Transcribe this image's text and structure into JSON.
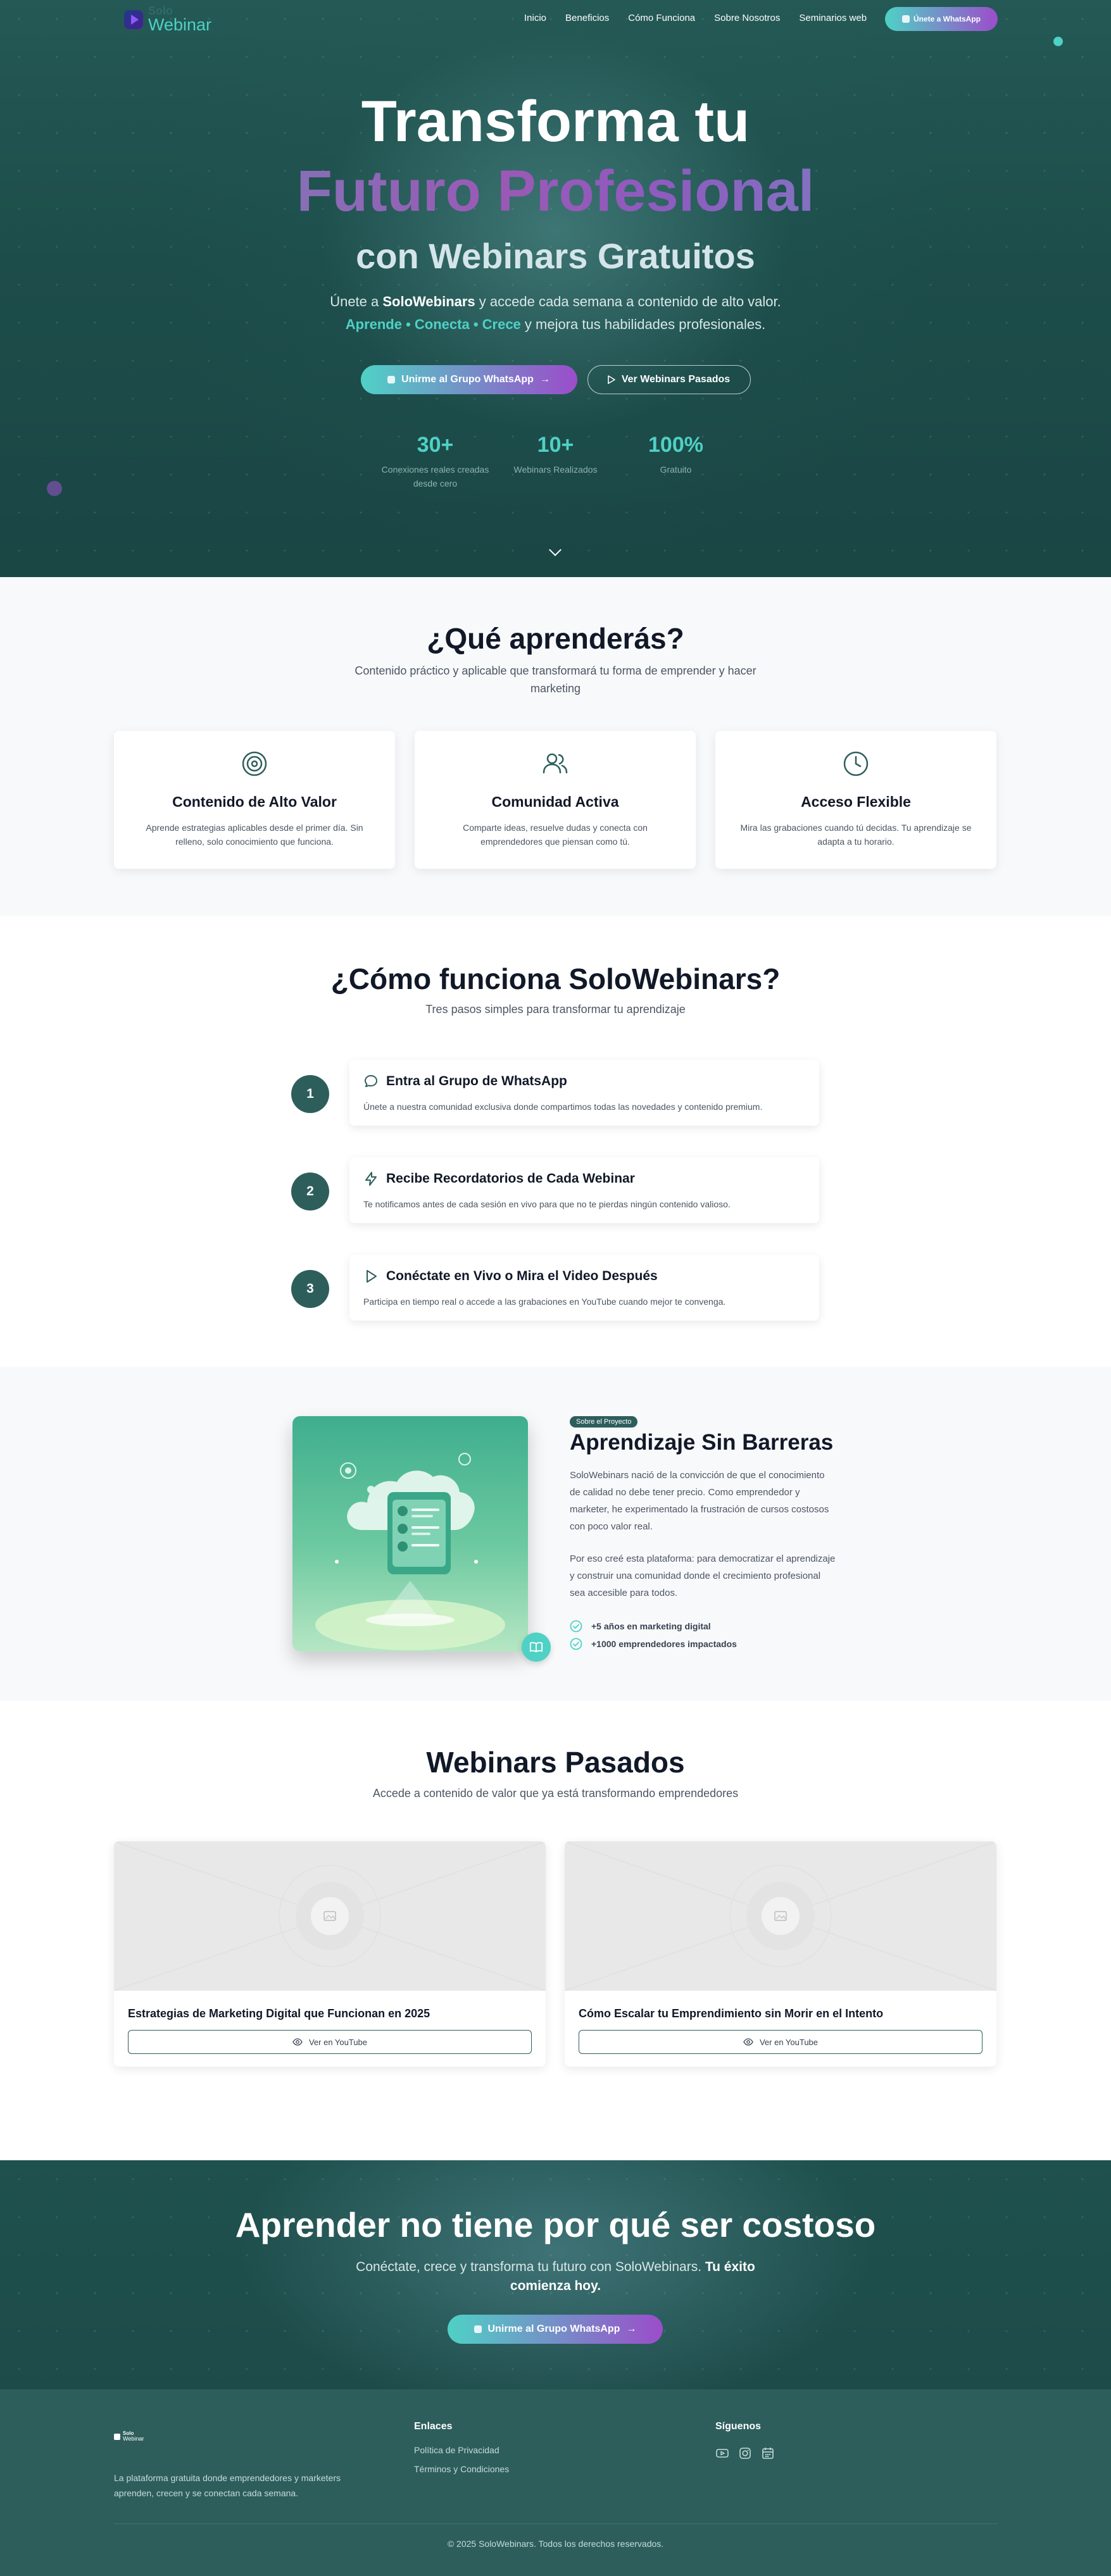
{
  "colors": {
    "primary": "#2d5e5c",
    "accent": "#4fd1c5",
    "purple": "#9b4dca",
    "hero_bg": "#1d4d4a"
  },
  "nav": {
    "logo_top": "Solo",
    "logo_bottom": "Webinar",
    "links": [
      "Inicio",
      "Beneficios",
      "Cómo Funciona",
      "Sobre Nosotros",
      "Seminarios web"
    ],
    "cta": "Únete a WhatsApp"
  },
  "hero": {
    "title_line1": "Transforma tu",
    "title_line2": "Futuro Profesional",
    "title_line3": "con Webinars Gratuitos",
    "sub_prefix": "Únete a ",
    "sub_brand": "SoloWebinars",
    "sub_suffix": " y accede cada semana a contenido de alto valor.",
    "highlight": "Aprende • Conecta • Crece",
    "sub2_suffix": " y mejora tus habilidades profesionales.",
    "btn_primary": "Unirme al Grupo WhatsApp",
    "btn_secondary": "Ver Webinars Pasados",
    "stats": [
      {
        "value": "30+",
        "label": "Conexiones reales creadas desde cero"
      },
      {
        "value": "10+",
        "label": "Webinars Realizados"
      },
      {
        "value": "100%",
        "label": "Gratuito"
      }
    ]
  },
  "learn": {
    "title": "¿Qué aprenderás?",
    "subtitle": "Contenido práctico y aplicable que transformará tu forma de emprender y hacer marketing",
    "cards": [
      {
        "icon": "target-icon",
        "title": "Contenido de Alto Valor",
        "text": "Aprende estrategias aplicables desde el primer día. Sin relleno, solo conocimiento que funciona."
      },
      {
        "icon": "users-icon",
        "title": "Comunidad Activa",
        "text": "Comparte ideas, resuelve dudas y conecta con emprendedores que piensan como tú."
      },
      {
        "icon": "clock-icon",
        "title": "Acceso Flexible",
        "text": "Mira las grabaciones cuando tú decidas. Tu aprendizaje se adapta a tu horario."
      }
    ]
  },
  "how": {
    "title": "¿Cómo funciona SoloWebinars?",
    "subtitle": "Tres pasos simples para transformar tu aprendizaje",
    "steps": [
      {
        "num": "1",
        "icon": "chat-icon",
        "title": "Entra al Grupo de WhatsApp",
        "text": "Únete a nuestra comunidad exclusiva donde compartimos todas las novedades y contenido premium."
      },
      {
        "num": "2",
        "icon": "bolt-icon",
        "title": "Recibe Recordatorios de Cada Webinar",
        "text": "Te notificamos antes de cada sesión en vivo para que no te pierdas ningún contenido valioso."
      },
      {
        "num": "3",
        "icon": "play-icon",
        "title": "Conéctate en Vivo o Mira el Video Después",
        "text": "Participa en tiempo real o accede a las grabaciones en YouTube cuando mejor te convenga."
      }
    ]
  },
  "about": {
    "tag": "Sobre el Proyecto",
    "title": "Aprendizaje Sin Barreras",
    "p1": "SoloWebinars nació de la convicción de que el conocimiento de calidad no debe tener precio. Como emprendedor y marketer, he experimentado la frustración de cursos costosos con poco valor real.",
    "p2": "Por eso creé esta plataforma: para democratizar el aprendizaje y construir una comunidad donde el crecimiento profesional sea accesible para todos.",
    "checks": [
      "+5 años en marketing digital",
      "+1000 emprendedores impactados"
    ]
  },
  "past": {
    "title": "Webinars Pasados",
    "subtitle": "Accede a contenido de valor que ya está transformando emprendedores",
    "videos": [
      {
        "title": "Estrategias de Marketing Digital que Funcionan en 2025",
        "button": "Ver en YouTube"
      },
      {
        "title": "Cómo Escalar tu Emprendimiento sin Morir en el Intento",
        "button": "Ver en YouTube"
      }
    ]
  },
  "cta": {
    "title": "Aprender no tiene por qué ser costoso",
    "sub": "Conéctate, crece y transforma tu futuro con SoloWebinars. ",
    "sub_bold": "Tu éxito comienza hoy.",
    "button": "Unirme al Grupo WhatsApp"
  },
  "footer": {
    "logo_top": "Solo",
    "logo_bottom": "Webinar",
    "description": "La plataforma gratuita donde emprendedores y marketers aprenden, crecen y se conectan cada semana.",
    "links_title": "Enlaces",
    "links": [
      "Política de Privacidad",
      "Términos y Condiciones"
    ],
    "social_title": "Síguenos",
    "social_icons": [
      "youtube-icon",
      "instagram-icon",
      "calendar-icon"
    ],
    "copyright": "© 2025 SoloWebinars. Todos los derechos reservados."
  }
}
